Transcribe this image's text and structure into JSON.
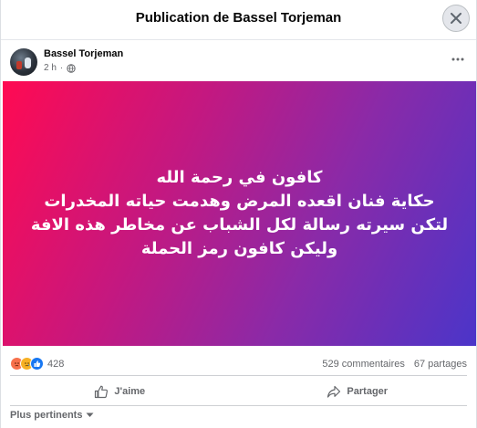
{
  "dialog": {
    "title": "Publication de Bassel Torjeman",
    "close_icon": "close-icon"
  },
  "post": {
    "author": "Bassel Torjeman",
    "time": "2 h",
    "time_sep": "·",
    "audience_icon": "globe-icon",
    "more_icon": "more-horizontal-icon",
    "lines": [
      "كافون في رحمة الله",
      "حكاية فنان اقعده المرض وهدمت حياته المخدرات",
      "لتكن سيرته رسالة لكل الشباب عن مخاطر هذه الافة",
      "وليكن كافون رمز الحملة"
    ],
    "background_colors": [
      "#ff0a52",
      "#c41880",
      "#8a2aa8",
      "#4b35c9"
    ]
  },
  "stats": {
    "reaction_icons": [
      "angry-icon",
      "sad-icon",
      "like-icon"
    ],
    "reaction_count": "428",
    "comments": "529 commentaires",
    "shares": "67 partages"
  },
  "actions": {
    "like_label": "J'aime",
    "share_label": "Partager"
  },
  "comments_sort": {
    "label": "Plus pertinents"
  },
  "colors": {
    "secondary_text": "#65676b",
    "like_blue": "#1877f2",
    "angry_orange": "#f7714c",
    "sad_yellow": "#f7b125"
  }
}
